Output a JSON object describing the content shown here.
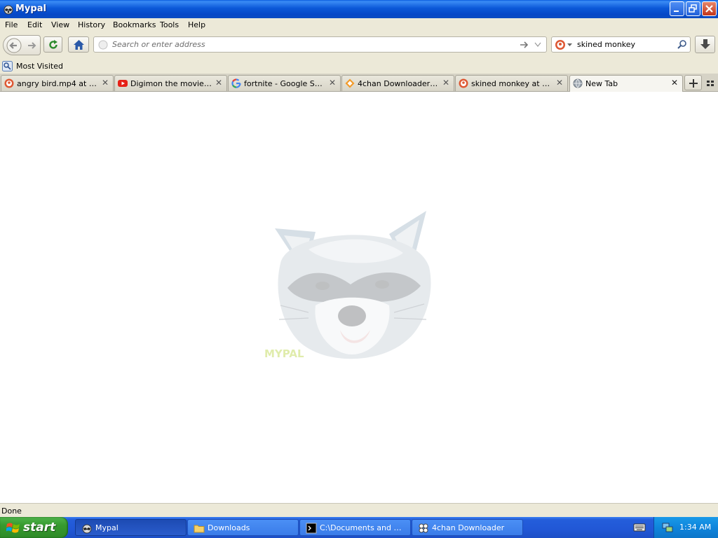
{
  "window": {
    "title": "Mypal"
  },
  "menu": {
    "items": [
      "File",
      "Edit",
      "View",
      "History",
      "Bookmarks",
      "Tools",
      "Help"
    ]
  },
  "navbar": {
    "url_placeholder": "Search or enter address",
    "search_value": "skined monkey"
  },
  "bookmarks": {
    "items": [
      {
        "label": "Most Visited",
        "icon": "most-visited-icon"
      }
    ]
  },
  "tabs": [
    {
      "label": "angry bird.mp4 at Duc...",
      "icon": "duckduckgo-icon",
      "active": false
    },
    {
      "label": "Digimon the movie - Yo...",
      "icon": "youtube-icon",
      "active": false
    },
    {
      "label": "fortnite - Google Search",
      "icon": "google-icon",
      "active": false
    },
    {
      "label": "4chan Downloader do...",
      "icon": "diamond-icon",
      "active": false
    },
    {
      "label": "skined monkey at Duck...",
      "icon": "duckduckgo-icon",
      "active": false
    },
    {
      "label": "New Tab",
      "icon": "globe-icon",
      "active": true
    }
  ],
  "content": {
    "watermark_text": "MYPAL"
  },
  "status": {
    "text": "Done"
  },
  "taskbar": {
    "start_label": "start",
    "tasks": [
      {
        "label": "Mypal",
        "icon": "raccoon-icon",
        "active": true
      },
      {
        "label": "Downloads",
        "icon": "folder-icon",
        "active": false
      },
      {
        "label": "C:\\Documents and Se...",
        "icon": "console-icon",
        "active": false
      },
      {
        "label": "4chan Downloader",
        "icon": "clover-icon",
        "active": false
      }
    ],
    "clock": "1:34 AM"
  },
  "colors": {
    "xp_blue": "#245edb",
    "start_green": "#379a2f",
    "chrome_beige": "#ece9d8"
  }
}
